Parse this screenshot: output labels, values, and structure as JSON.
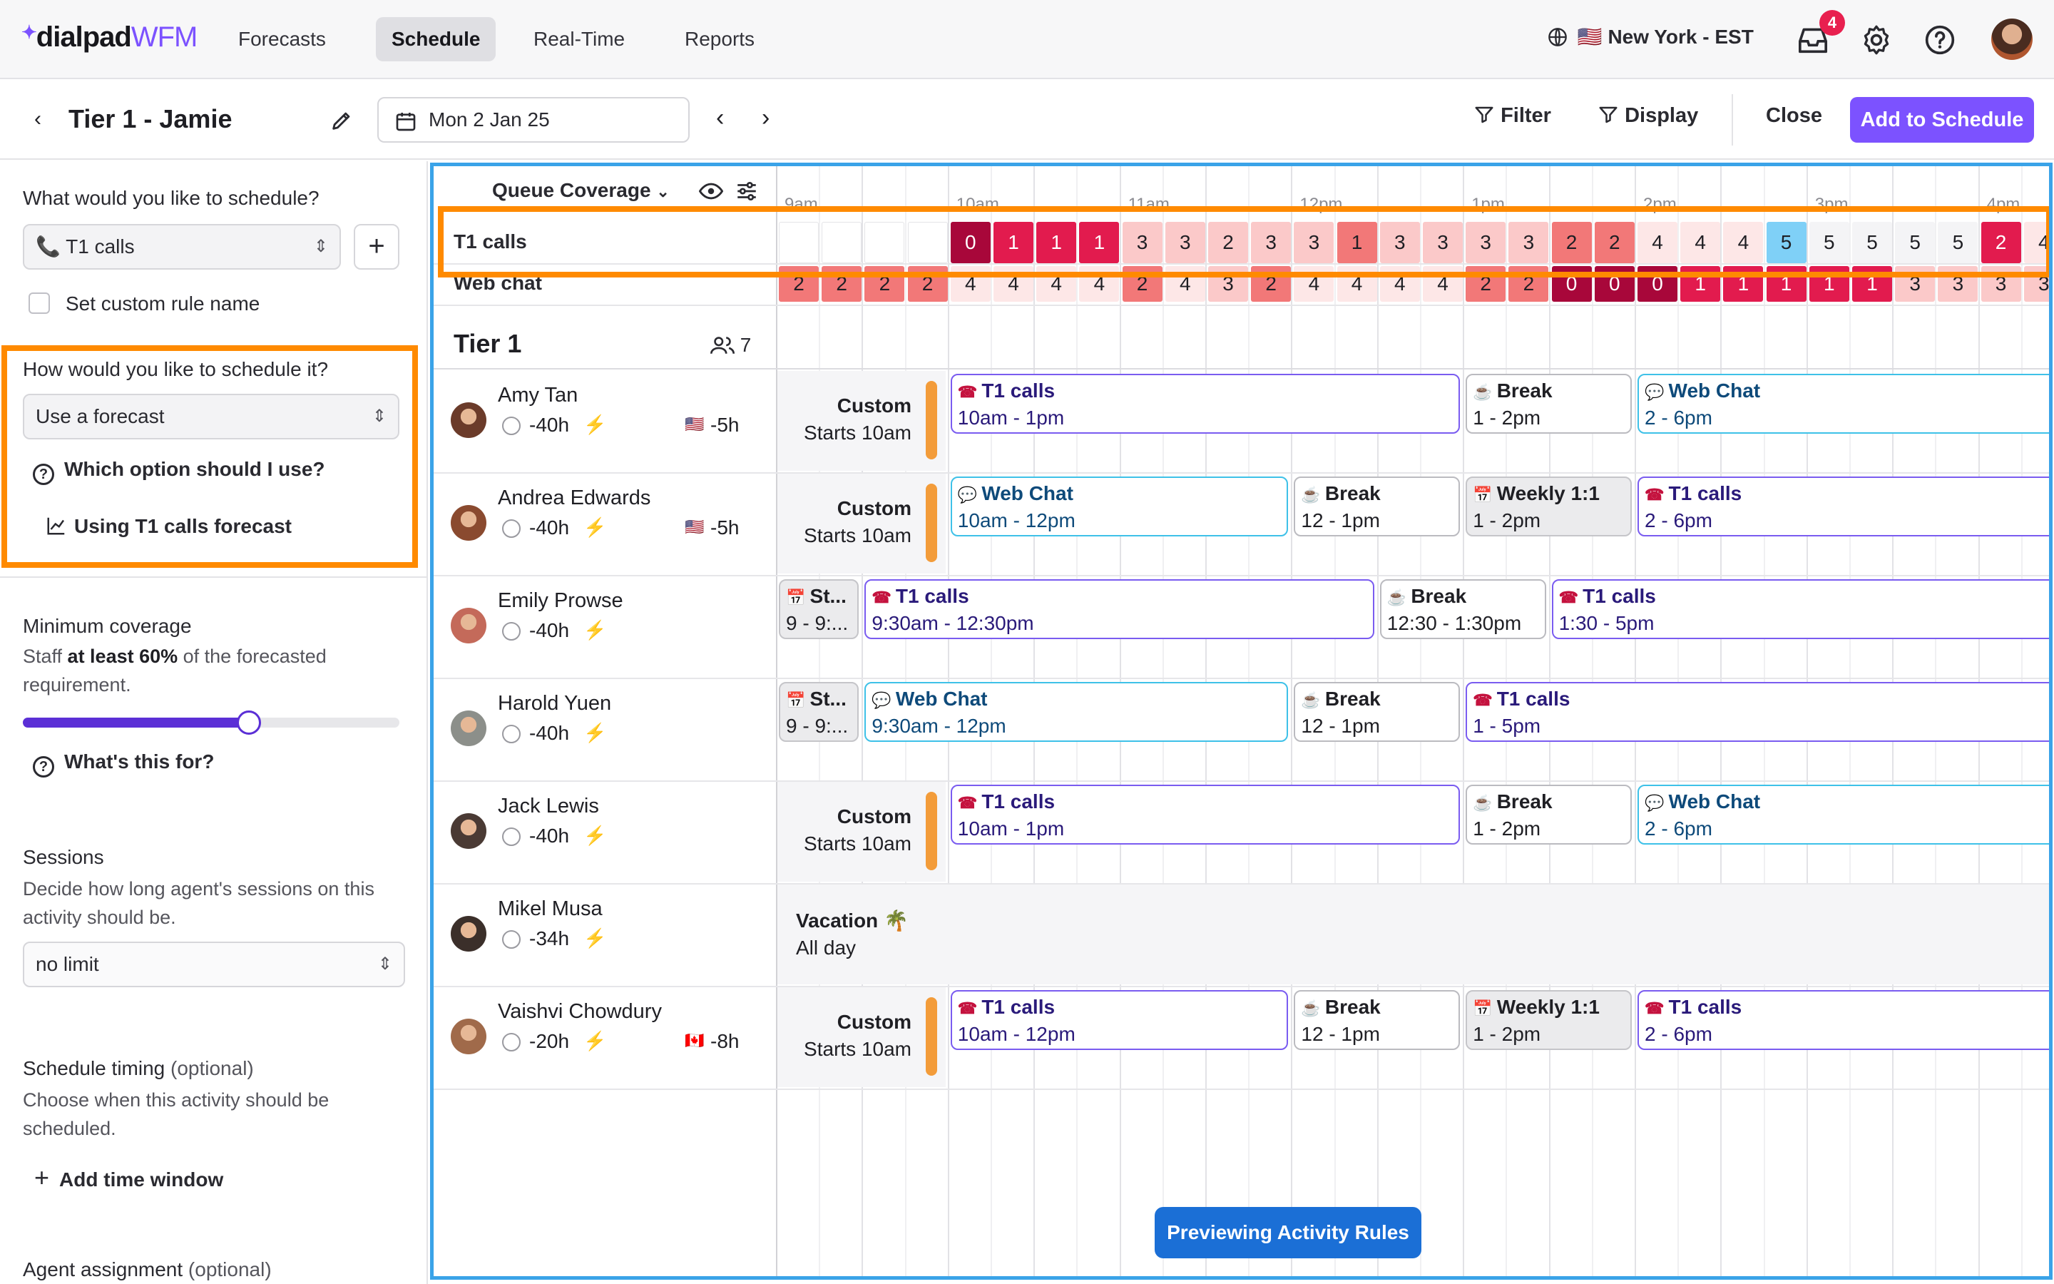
{
  "app": {
    "logo_main": "dialpad",
    "logo_accent": "WFM"
  },
  "nav": {
    "items": [
      "Forecasts",
      "Schedule",
      "Real-Time",
      "Reports"
    ],
    "active": "Schedule"
  },
  "header": {
    "timezone": "New York - EST",
    "flag": "🇺🇸",
    "notif_count": "4"
  },
  "toolbar": {
    "title": "Tier 1 - Jamie",
    "date": "Mon 2 Jan 25",
    "filter": "Filter",
    "display": "Display",
    "close": "Close",
    "add": "Add to Schedule"
  },
  "sidebar": {
    "q1": "What would you like to schedule?",
    "activity": "📞 T1 calls",
    "custom_rule": "Set custom rule name",
    "q2": "How would you like to schedule it?",
    "method": "Use a forecast",
    "which_option": "Which option should I use?",
    "using_forecast": "Using T1 calls forecast",
    "min_cov_title": "Minimum coverage",
    "min_cov_desc_a": "Staff ",
    "min_cov_desc_b": "at least 60%",
    "min_cov_desc_c": " of the forecasted requirement.",
    "min_cov_value": 0.6,
    "whats_this": "What's this for?",
    "sessions_title": "Sessions",
    "sessions_desc": "Decide how long agent's sessions on this activity should be.",
    "sessions_value": "no limit",
    "timing_title": "Schedule timing",
    "timing_opt": "(optional)",
    "timing_desc": "Choose when this activity should be scheduled.",
    "add_window": "Add time window",
    "agent_title": "Agent assignment",
    "agent_opt": "(optional)"
  },
  "schedule": {
    "coverage_label": "Queue Coverage",
    "hours": [
      "9am",
      "10am",
      "11am",
      "12pm",
      "1pm",
      "2pm",
      "3pm",
      "4pm"
    ],
    "queues": [
      {
        "name": "T1 calls",
        "values": [
          "",
          "",
          "",
          "",
          "0",
          "1",
          "1",
          "1",
          "3",
          "3",
          "2",
          "3",
          "3",
          "1",
          "3",
          "3",
          "3",
          "3",
          "2",
          "2",
          "4",
          "4",
          "4",
          "5",
          "5",
          "5",
          "5",
          "5",
          "2",
          "4"
        ]
      },
      {
        "name": "Web chat",
        "values": [
          "2",
          "2",
          "2",
          "2",
          "4",
          "4",
          "4",
          "4",
          "2",
          "4",
          "3",
          "2",
          "4",
          "4",
          "4",
          "4",
          "2",
          "2",
          "0",
          "0",
          "0",
          "1",
          "1",
          "1",
          "1",
          "1",
          "3",
          "3",
          "3",
          "3",
          "3"
        ]
      }
    ],
    "team": "Tier 1",
    "team_count": "7",
    "agents": [
      {
        "name": "Amy Tan",
        "hours": "-40h",
        "flag": "🇺🇸",
        "offset": "-5h",
        "kind": "custom",
        "blocks": [
          {
            "type": "call",
            "title": "T1 calls",
            "time": "10am - 1pm"
          },
          {
            "type": "break",
            "title": "Break",
            "time": "1 - 2pm"
          },
          {
            "type": "chat",
            "title": "Web Chat",
            "time": "2 - 6pm"
          }
        ]
      },
      {
        "name": "Andrea Edwards",
        "hours": "-40h",
        "flag": "🇺🇸",
        "offset": "-5h",
        "kind": "custom",
        "blocks": [
          {
            "type": "chat",
            "title": "Web Chat",
            "time": "10am - 12pm"
          },
          {
            "type": "break",
            "title": "Break",
            "time": "12 - 1pm"
          },
          {
            "type": "gray",
            "title": "Weekly 1:1",
            "time": "1 - 2pm"
          },
          {
            "type": "call",
            "title": "T1 calls",
            "time": "2 - 6pm"
          }
        ]
      },
      {
        "name": "Emily Prowse",
        "hours": "-40h",
        "flag": "",
        "offset": "",
        "kind": "none",
        "blocks": [
          {
            "type": "gray",
            "title": "St...",
            "time": "9 - 9:..."
          },
          {
            "type": "call",
            "title": "T1 calls",
            "time": "9:30am - 12:30pm"
          },
          {
            "type": "break",
            "title": "Break",
            "time": "12:30 - 1:30pm"
          },
          {
            "type": "call",
            "title": "T1 calls",
            "time": "1:30 - 5pm"
          }
        ]
      },
      {
        "name": "Harold Yuen",
        "hours": "-40h",
        "flag": "",
        "offset": "",
        "kind": "none",
        "blocks": [
          {
            "type": "gray",
            "title": "St...",
            "time": "9 - 9:..."
          },
          {
            "type": "chat",
            "title": "Web Chat",
            "time": "9:30am - 12pm"
          },
          {
            "type": "break",
            "title": "Break",
            "time": "12 - 1pm"
          },
          {
            "type": "call",
            "title": "T1 calls",
            "time": "1 - 5pm"
          }
        ]
      },
      {
        "name": "Jack Lewis",
        "hours": "-40h",
        "flag": "",
        "offset": "",
        "kind": "custom",
        "blocks": [
          {
            "type": "call",
            "title": "T1 calls",
            "time": "10am - 1pm"
          },
          {
            "type": "break",
            "title": "Break",
            "time": "1 - 2pm"
          },
          {
            "type": "chat",
            "title": "Web Chat",
            "time": "2 - 6pm"
          }
        ]
      },
      {
        "name": "Mikel Musa",
        "hours": "-34h",
        "flag": "",
        "offset": "",
        "kind": "vacation",
        "vacation_title": "Vacation 🌴",
        "vacation_time": "All day",
        "blocks": []
      },
      {
        "name": "Vaishvi Chowdury",
        "hours": "-20h",
        "flag": "🇨🇦",
        "offset": "-8h",
        "kind": "custom",
        "blocks": [
          {
            "type": "call",
            "title": "T1 calls",
            "time": "10am - 12pm"
          },
          {
            "type": "break",
            "title": "Break",
            "time": "12 - 1pm"
          },
          {
            "type": "gray",
            "title": "Weekly 1:1",
            "time": "1 - 2pm"
          },
          {
            "type": "call",
            "title": "T1 calls",
            "time": "2 - 6pm"
          }
        ]
      }
    ],
    "custom_title": "Custom",
    "custom_sub": "Starts 10am",
    "preview_label": "Previewing Activity Rules",
    "colors": {
      "accent": "#7c52ff",
      "panel_border": "#3aa3e8",
      "highlight": "#ff8a00"
    }
  }
}
